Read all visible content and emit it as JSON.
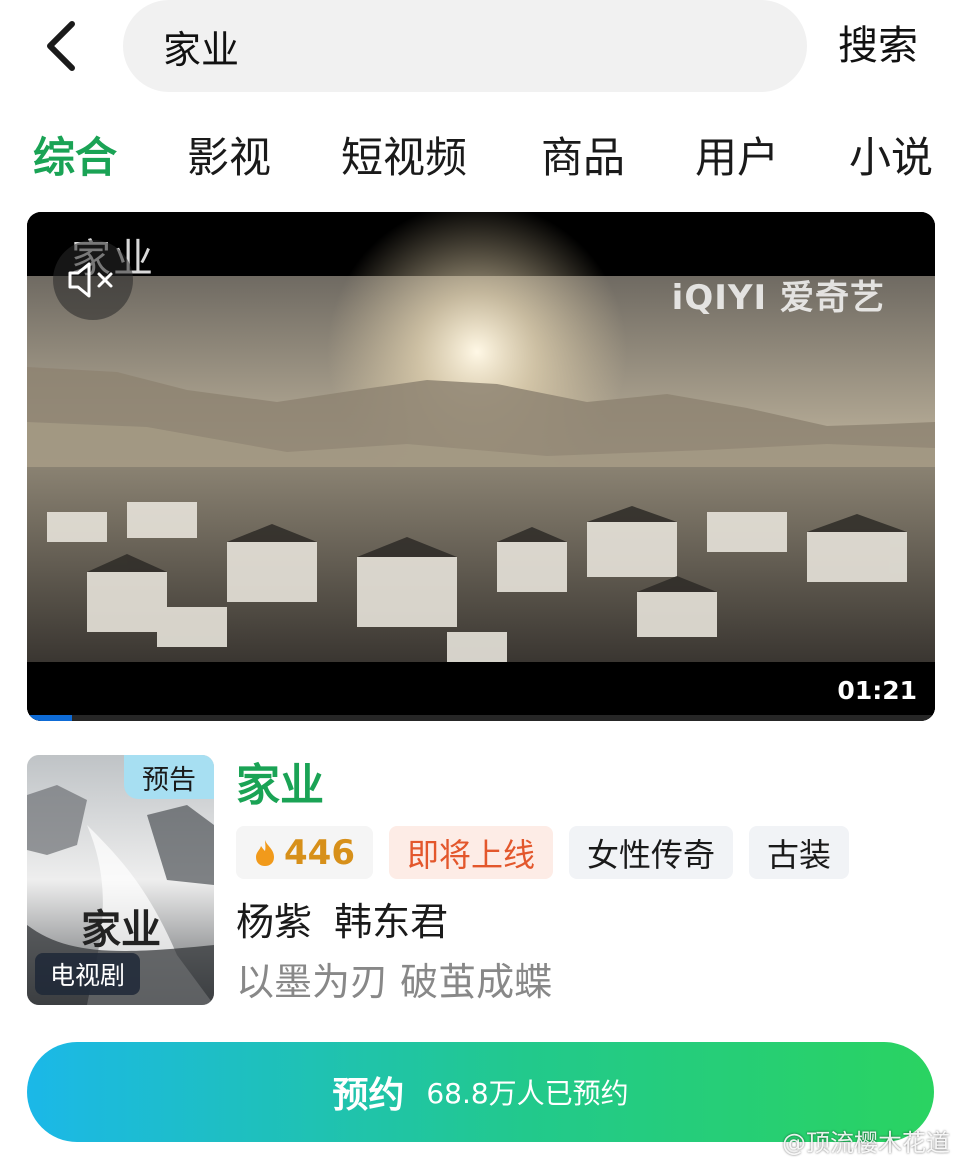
{
  "search": {
    "query": "家业",
    "submit_label": "搜索"
  },
  "tabs": [
    {
      "label": "综合",
      "active": true
    },
    {
      "label": "影视",
      "active": false
    },
    {
      "label": "短视频",
      "active": false
    },
    {
      "label": "商品",
      "active": false
    },
    {
      "label": "用户",
      "active": false
    },
    {
      "label": "小说",
      "active": false
    }
  ],
  "video": {
    "overlay_title": "家业",
    "watermark": "iQIYI 爱奇艺",
    "duration": "01:21",
    "progress_fraction": 0.05,
    "icons": {
      "mute": "volume-mute-icon"
    }
  },
  "show": {
    "poster_badge_top": "预告",
    "poster_badge_bottom": "电视剧",
    "poster_title": "家业",
    "title": "家业",
    "heat": "446",
    "status_tag": "即将上线",
    "genre_tags": [
      "女性传奇",
      "古装"
    ],
    "cast": "杨紫  韩东君",
    "slogan": "以墨为刃 破茧成蝶"
  },
  "reserve": {
    "label": "预约",
    "count_text": "68.8万人已预约"
  },
  "credit": "@顶流樱木花道",
  "colors": {
    "accent_green": "#1aa355",
    "status_red": "#e3572c",
    "heat_orange": "#d7901a",
    "button_gradient_start": "#1bb8e8",
    "button_gradient_end": "#2ad361"
  }
}
